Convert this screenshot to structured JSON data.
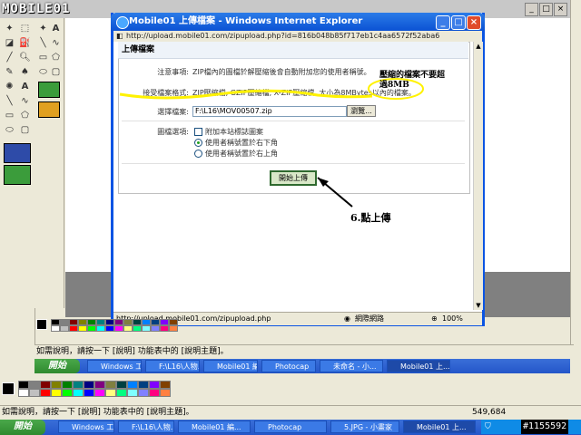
{
  "watermark": "MOBILE01",
  "paint": {
    "status_top": "如需說明，請按一下 [說明] 功能表中的 [說明主題]。",
    "status_bottom": "如需說明，請按一下 [說明] 功能表中的 [說明主題]。",
    "coords": "549,684"
  },
  "ie": {
    "title": "Mobile01 上傳檔案 - Windows Internet Explorer",
    "address": "http://upload.mobile01.com/zipupload.php?id=816b048b85f717eb1c4aa6572f52aba6",
    "status_url": "http://upload.mobile01.com/zipupload.php",
    "zone": "網際網路",
    "zoom": "100%"
  },
  "upload": {
    "heading": "上傳檔案",
    "notice_label": "注意事項:",
    "notice_text": "ZIP檔內的圖檔於解壓縮後會自動附加您的使用者稱號。",
    "formats_label": "接受檔案格式:",
    "formats_text": "ZIP壓縮檔, GZIP壓縮檔, X-ZIP壓縮檔, 大小為8MBytes以內的檔案。",
    "file_label": "選擇檔案:",
    "file_value": "F:\\L16\\MOV00507.zip",
    "browse_label": "瀏覽...",
    "options_label": "圖檔選項:",
    "option_watermark": "附加本站標誌圖案",
    "option_bottom_right": "使用者稱號置於右下角",
    "option_top_right": "使用者稱號置於右上角",
    "submit_label": "開始上傳"
  },
  "annotations": {
    "size_note": "壓縮的檔案不要超過8MB",
    "step_note": "6.點上傳"
  },
  "taskbar_top": {
    "start": "開始",
    "items": [
      "Windows 工...",
      "F:\\L16\\人物...",
      "Mobile01 編...",
      "Photocap",
      "未命名 - 小...",
      "Mobile01 上..."
    ]
  },
  "taskbar": {
    "start": "開始",
    "items": [
      "Windows 工...",
      "F:\\L16\\人物...",
      "Mobile01 編...",
      "Photocap",
      "5.JPG - 小畫家",
      "Mobile01 上..."
    ]
  },
  "footer_badge": "#1155592",
  "colors": {
    "ie_title": "#0b52d4",
    "taskbar": "#2456c9",
    "highlight": "#fff200",
    "submit_border": "#2f6a2f"
  }
}
